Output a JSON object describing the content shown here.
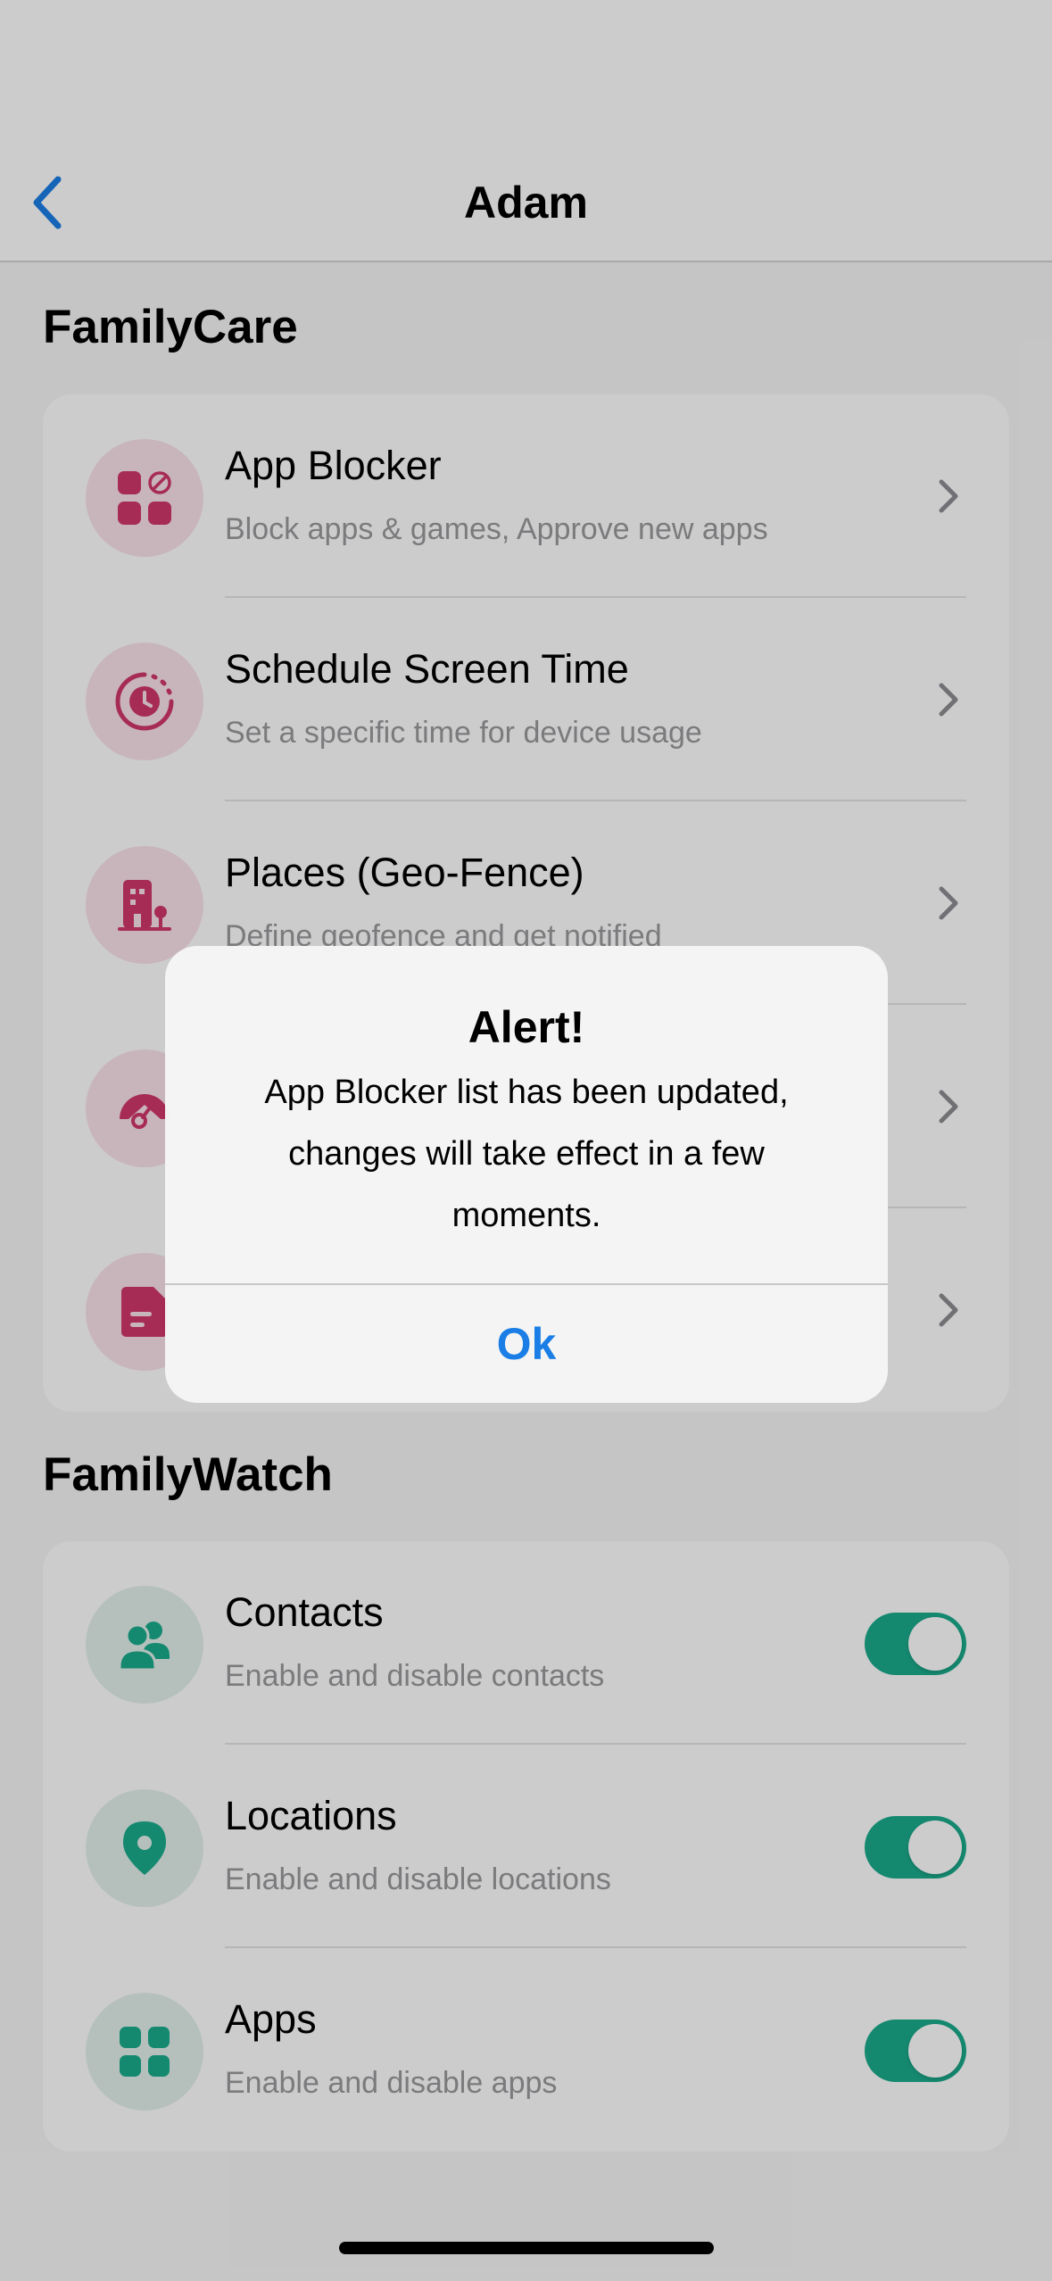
{
  "nav": {
    "title": "Adam",
    "back_icon": "chevron-left-icon"
  },
  "familycare": {
    "title": "FamilyCare",
    "items": [
      {
        "title": "App Blocker",
        "subtitle": "Block apps & games, Approve new apps",
        "icon": "app-blocker-icon"
      },
      {
        "title": "Schedule Screen Time",
        "subtitle": "Set a specific time for device usage",
        "icon": "timer-icon"
      },
      {
        "title": "Places (Geo-Fence)",
        "subtitle": "Define geofence and get notified",
        "icon": "building-icon"
      },
      {
        "title": "",
        "subtitle": "",
        "icon": "speedometer-icon"
      },
      {
        "title": "",
        "subtitle": "",
        "icon": "note-icon"
      }
    ]
  },
  "familywatch": {
    "title": "FamilyWatch",
    "items": [
      {
        "title": "Contacts",
        "subtitle": "Enable and disable contacts",
        "icon": "contacts-icon",
        "enabled": true
      },
      {
        "title": "Locations",
        "subtitle": "Enable and disable locations",
        "icon": "location-pin-icon",
        "enabled": true
      },
      {
        "title": "Apps",
        "subtitle": "Enable and disable apps",
        "icon": "apps-grid-icon",
        "enabled": true
      }
    ]
  },
  "alert": {
    "title": "Alert!",
    "message": "App Blocker list has been updated, changes will take effect in a few moments.",
    "ok_label": "Ok"
  },
  "colors": {
    "accent_blue": "#1a7ee6",
    "pink": "#d1386b",
    "green": "#1aac8c",
    "toggle_on": "#1aac8c"
  }
}
